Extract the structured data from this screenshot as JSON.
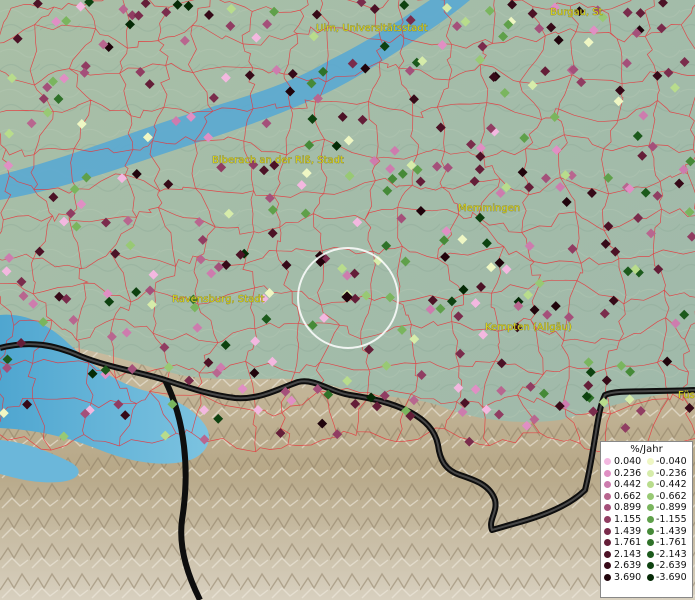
{
  "map": {
    "cities": [
      {
        "name": "Ulm, Universitätsstadt"
      },
      {
        "name": "Burgau, St"
      },
      {
        "name": "Biberach an der Riß, Stadt"
      },
      {
        "name": "Memmingen"
      },
      {
        "name": "Ravensburg, Stadt"
      },
      {
        "name": "Kempten (Allgäu)"
      },
      {
        "name": "Füs"
      }
    ],
    "colors": {
      "borders": "#e8343a",
      "lake": "#5fb2d6",
      "river": "#4a9fca",
      "country_border": "#101010",
      "selection_ring": "#ffffff"
    }
  },
  "legend": {
    "title": "%/Jahr",
    "rows": [
      {
        "pos": "0.040",
        "neg": "-0.040",
        "pos_color": "#f3b8e0",
        "neg_color": "#eff7c4"
      },
      {
        "pos": "0.236",
        "neg": "-0.236",
        "pos_color": "#e08fc4",
        "neg_color": "#d6ecaa"
      },
      {
        "pos": "0.442",
        "neg": "-0.442",
        "pos_color": "#cd7cae",
        "neg_color": "#b8dc8c"
      },
      {
        "pos": "0.662",
        "neg": "-0.662",
        "pos_color": "#b8668f",
        "neg_color": "#98c974"
      },
      {
        "pos": "0.899",
        "neg": "-0.899",
        "pos_color": "#a4507a",
        "neg_color": "#7ab55e"
      },
      {
        "pos": "1.155",
        "neg": "-1.155",
        "pos_color": "#903d62",
        "neg_color": "#5fa04a"
      },
      {
        "pos": "1.439",
        "neg": "-1.439",
        "pos_color": "#7a2c4c",
        "neg_color": "#468a38"
      },
      {
        "pos": "1.761",
        "neg": "-1.761",
        "pos_color": "#641e38",
        "neg_color": "#2f7229"
      },
      {
        "pos": "2.143",
        "neg": "-2.143",
        "pos_color": "#4c1226",
        "neg_color": "#1c5a1c"
      },
      {
        "pos": "2.639",
        "neg": "-2.639",
        "pos_color": "#360a18",
        "neg_color": "#0e4210"
      },
      {
        "pos": "3.690",
        "neg": "-3.690",
        "pos_color": "#20040c",
        "neg_color": "#052a06"
      }
    ]
  }
}
